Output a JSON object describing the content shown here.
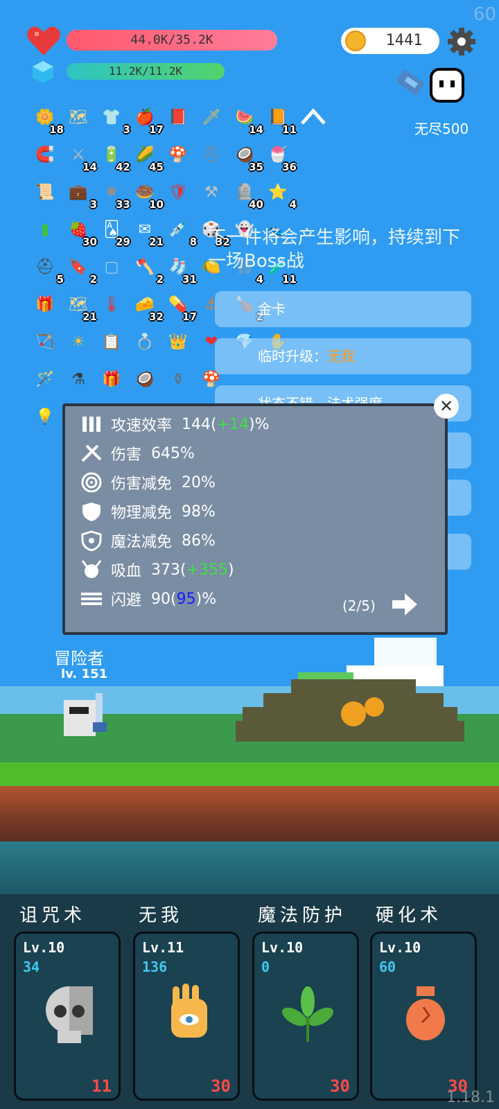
{
  "fps": "60",
  "version": "1.18.1",
  "hp": {
    "text": "44.0K/35.2K"
  },
  "mp": {
    "text": "11.2K/11.2K"
  },
  "coins": "1441",
  "mode": "无尽500",
  "items": [
    {
      "icon": "flower-icon",
      "glyph": "🌼",
      "count": "18",
      "color": "#ffffff"
    },
    {
      "icon": "treasure-map-icon",
      "glyph": "🗺",
      "count": "",
      "color": "#f0d890"
    },
    {
      "icon": "shirt-icon",
      "glyph": "👕",
      "count": "3",
      "color": "#9ad0f0"
    },
    {
      "icon": "apple-icon",
      "glyph": "🍎",
      "count": "17",
      "color": "#e83030"
    },
    {
      "icon": "skull-book-icon",
      "glyph": "📕",
      "count": "",
      "color": "#3a3f4a"
    },
    {
      "icon": "sword-icon",
      "glyph": "🗡",
      "count": "",
      "color": "#f0c040"
    },
    {
      "icon": "watermelon-icon",
      "glyph": "🍉",
      "count": "14",
      "color": "#e84a4a"
    },
    {
      "icon": "book-icon",
      "glyph": "📙",
      "count": "11",
      "color": "#f0a030"
    },
    {
      "icon": "magnet-icon",
      "glyph": "🧲",
      "count": "",
      "color": "#e83030"
    },
    {
      "icon": "broadsword-icon",
      "glyph": "⚔",
      "count": "14",
      "color": "#c0c0c0"
    },
    {
      "icon": "battery-icon",
      "glyph": "🔋",
      "count": "42",
      "color": "#f0c040"
    },
    {
      "icon": "corn-icon",
      "glyph": "🌽",
      "count": "45",
      "color": "#f0c040"
    },
    {
      "icon": "mushroom-icon",
      "glyph": "🍄",
      "count": "",
      "color": "#e83030"
    },
    {
      "icon": "helmet-icon",
      "glyph": "⛑",
      "count": "",
      "color": "#8a8a8a"
    },
    {
      "icon": "coconut-icon",
      "glyph": "🥥",
      "count": "35",
      "color": "#6a4a2a"
    },
    {
      "icon": "ice-cream-icon",
      "glyph": "🍧",
      "count": "36",
      "color": "#f090c0"
    },
    {
      "icon": "scroll-icon",
      "glyph": "📜",
      "count": "",
      "color": "#f0c060"
    },
    {
      "icon": "briefcase-icon",
      "glyph": "💼",
      "count": "3",
      "color": "#f0a030"
    },
    {
      "icon": "spiked-ball-icon",
      "glyph": "✹",
      "count": "33",
      "color": "#909090"
    },
    {
      "icon": "donut-icon",
      "glyph": "🍩",
      "count": "10",
      "color": "#c07040"
    },
    {
      "icon": "shield-icon",
      "glyph": "🛡",
      "count": "",
      "color": "#e83030"
    },
    {
      "icon": "mace-icon",
      "glyph": "⚒",
      "count": "",
      "color": "#c0c0c0"
    },
    {
      "icon": "tombstone-icon",
      "glyph": "🪦",
      "count": "40",
      "color": "#a0a0a0"
    },
    {
      "icon": "star-card-icon",
      "glyph": "⭐",
      "count": "4",
      "color": "#7ac0f0"
    },
    {
      "icon": "green-card-icon",
      "glyph": "▮",
      "count": "",
      "color": "#40c040"
    },
    {
      "icon": "strawberry-icon",
      "glyph": "🍓",
      "count": "30",
      "color": "#e83030"
    },
    {
      "icon": "playing-cards-icon",
      "glyph": "🂡",
      "count": "29",
      "color": "#ffffff"
    },
    {
      "icon": "envelope-icon",
      "glyph": "✉",
      "count": "21",
      "color": "#ffffff"
    },
    {
      "icon": "syringe-icon",
      "glyph": "💉",
      "count": "8",
      "color": "#7ad0f0"
    },
    {
      "icon": "dice-icon",
      "glyph": "🎲",
      "count": "32",
      "color": "#ffffff"
    },
    {
      "icon": "ghost-icon",
      "glyph": "👻",
      "count": "",
      "color": "#ffffff"
    },
    {
      "icon": "sneaker-icon",
      "glyph": "👟",
      "count": "",
      "color": "#e83030"
    },
    {
      "icon": "hood-icon",
      "glyph": "⛑",
      "count": "5",
      "color": "#4a4a4a"
    },
    {
      "icon": "bookmark-icon",
      "glyph": "🔖",
      "count": "2",
      "color": "#e83030"
    },
    {
      "icon": "blank-card-icon",
      "glyph": "▢",
      "count": "",
      "color": "#9ad0f0"
    },
    {
      "icon": "battle-axe-icon",
      "glyph": "🪓",
      "count": "2",
      "color": "#a0a0a0"
    },
    {
      "icon": "sock-icon",
      "glyph": "🧦",
      "count": "31",
      "color": "#e83030"
    },
    {
      "icon": "lime-icon",
      "glyph": "🍋",
      "count": "",
      "color": "#60d040"
    },
    {
      "icon": "chain-icon",
      "glyph": "⛓",
      "count": "4",
      "color": "#a0a0a0"
    },
    {
      "icon": "potion-icon",
      "glyph": "🧪",
      "count": "11",
      "color": "#40a0f0"
    },
    {
      "icon": "gift-box-icon",
      "glyph": "🎁",
      "count": "",
      "color": "#8a5ad0"
    },
    {
      "icon": "map-icon",
      "glyph": "🗺",
      "count": "21",
      "color": "#f0d890"
    },
    {
      "icon": "thermometer-icon",
      "glyph": "🌡",
      "count": "",
      "color": "#e83030"
    },
    {
      "icon": "cheese-icon",
      "glyph": "🧀",
      "count": "32",
      "color": "#f0c040"
    },
    {
      "icon": "pill-icon",
      "glyph": "💊",
      "count": "17",
      "color": "#e83030"
    },
    {
      "icon": "hook-icon",
      "glyph": "⚓",
      "count": "",
      "color": "#e08030"
    },
    {
      "icon": "meat-icon",
      "glyph": "🍗",
      "count": "2",
      "color": "#a05a2a"
    },
    {
      "icon": "meteor-icon",
      "glyph": "☄",
      "count": "",
      "color": "#f0a030"
    },
    {
      "icon": "bow-icon",
      "glyph": "🏹",
      "count": "",
      "color": "#c08040"
    },
    {
      "icon": "sun-icon",
      "glyph": "☀",
      "count": "",
      "color": "#f0c040"
    },
    {
      "icon": "checklist-icon",
      "glyph": "📋",
      "count": "",
      "color": "#ffffff"
    },
    {
      "icon": "ring-icon",
      "glyph": "💍",
      "count": "",
      "color": "#f0c040"
    },
    {
      "icon": "crown-icon",
      "glyph": "👑",
      "count": "",
      "color": "#f0a030"
    },
    {
      "icon": "heart-item-icon",
      "glyph": "❤",
      "count": "",
      "color": "#e83030"
    },
    {
      "icon": "ruby-icon",
      "glyph": "💎",
      "count": "",
      "color": "#e83030"
    },
    {
      "icon": "hand-icon",
      "glyph": "✋",
      "count": "",
      "color": "#5a5a5a"
    },
    {
      "icon": "magic-wand-icon",
      "glyph": "🪄",
      "count": "",
      "color": "#f0c040"
    },
    {
      "icon": "cauldron-icon",
      "glyph": "⚗",
      "count": "",
      "color": "#3a3a3a"
    },
    {
      "icon": "present-icon",
      "glyph": "🎁",
      "count": "",
      "color": "#e83030"
    },
    {
      "icon": "coconut-drink-icon",
      "glyph": "🥥",
      "count": "",
      "color": "#8a5a2a"
    },
    {
      "icon": "mortar-icon",
      "glyph": "⚱",
      "count": "",
      "color": "#6a6a6a"
    },
    {
      "icon": "brown-mushroom-icon",
      "glyph": "🍄",
      "count": "",
      "color": "#8a4a2a"
    },
    {
      "icon": "lightbulb-card-icon",
      "glyph": "💡",
      "count": "",
      "color": "#2ac0c0"
    }
  ],
  "background_message": "下一件将会产生影响，持续到下一场Boss战",
  "background_cards": [
    {
      "text": "金卡",
      "value": ""
    },
    {
      "text": "临时升级：",
      "value": "无我"
    },
    {
      "text": "状态不错，法术强度",
      "value": ""
    }
  ],
  "stats": [
    {
      "icon": "bullets-icon",
      "name": "攻速效率",
      "value": "144",
      "paren_prefix": "(",
      "extra": "+14",
      "paren_suffix": ")",
      "suffix": "%",
      "extra_color": "green"
    },
    {
      "icon": "crossed-axes-icon",
      "name": "伤害",
      "value": "645%",
      "paren_prefix": "",
      "extra": "",
      "paren_suffix": "",
      "suffix": "",
      "extra_color": ""
    },
    {
      "icon": "target-icon",
      "name": "伤害减免",
      "value": "20%",
      "paren_prefix": "",
      "extra": "",
      "paren_suffix": "",
      "suffix": "",
      "extra_color": ""
    },
    {
      "icon": "shield-icon",
      "name": "物理减免",
      "value": "98%",
      "paren_prefix": "",
      "extra": "",
      "paren_suffix": "",
      "suffix": "",
      "extra_color": ""
    },
    {
      "icon": "magic-shield-icon",
      "name": "魔法减免",
      "value": "86%",
      "paren_prefix": "",
      "extra": "",
      "paren_suffix": "",
      "suffix": "",
      "extra_color": ""
    },
    {
      "icon": "horned-skull-icon",
      "name": "吸血",
      "value": "373",
      "paren_prefix": "(",
      "extra": "+355",
      "paren_suffix": ")",
      "suffix": "",
      "extra_color": "green"
    },
    {
      "icon": "dodge-lines-icon",
      "name": "闪避",
      "value": "90",
      "paren_prefix": "(",
      "extra": "95",
      "paren_suffix": ")",
      "suffix": "%",
      "extra_color": "blue"
    }
  ],
  "stats_page": "(2/5)",
  "hero": {
    "name": "冒险者",
    "level": "lv. 151"
  },
  "skills": [
    {
      "name": "诅咒术",
      "level": "Lv.10",
      "points": "34",
      "cost": "11",
      "icon": "skull-icon"
    },
    {
      "name": "无我",
      "level": "Lv.11",
      "points": "136",
      "cost": "30",
      "icon": "eye-hand-icon"
    },
    {
      "name": "魔法防护",
      "level": "Lv.10",
      "points": "0",
      "cost": "30",
      "icon": "leaf-icon"
    },
    {
      "name": "硬化术",
      "level": "Lv.10",
      "points": "60",
      "cost": "30",
      "icon": "vase-icon"
    }
  ],
  "colors": {
    "sky": "#2f9cf1",
    "hp": "#ff5a6e",
    "mp": "#2ec4c4",
    "accent_orange": "#ff9a1a",
    "plus_green": "#3ce046",
    "dodge_blue": "#1a1aff",
    "cost_red": "#ff4a4a",
    "points_cyan": "#3ec8f0"
  }
}
